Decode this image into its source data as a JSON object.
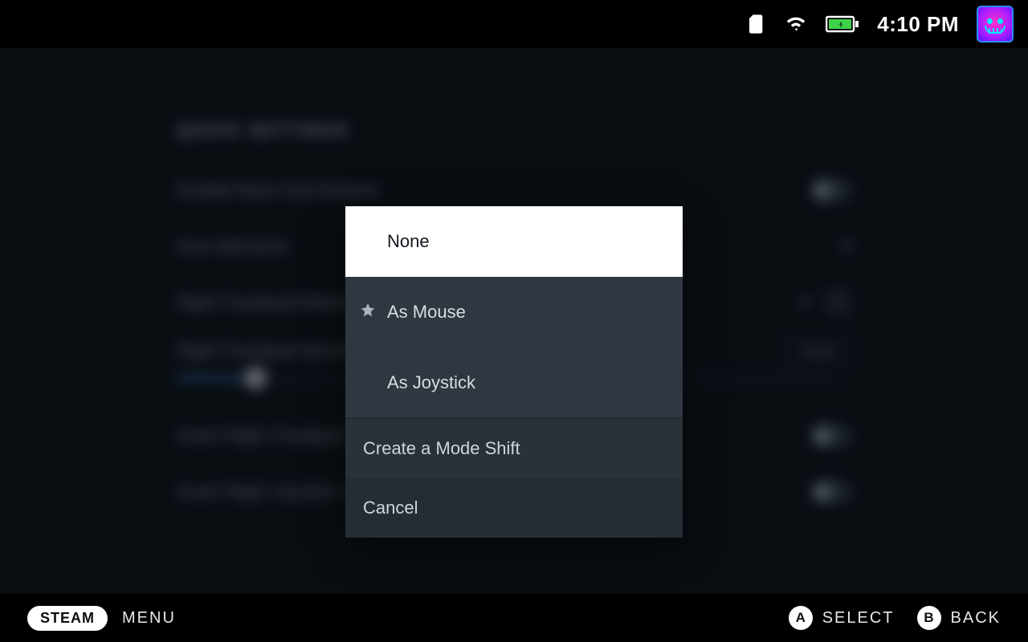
{
  "status": {
    "time": "4:10 PM"
  },
  "settings": {
    "section_title": "QUICK SETTINGS",
    "rows": {
      "r0": "Enable Back Grip Buttons",
      "r1": "Gyro Behavior",
      "r2": "Right Trackpad Behavior",
      "r3": "Right Trackpad Sensitivity",
      "invert_btn": "Invert",
      "r4": "Invert Right Trackpad Y-Axis",
      "r5": "Invert Right Joystick Y-Axis"
    }
  },
  "modal": {
    "options": {
      "o0": "None",
      "o1": "As Mouse",
      "o2": "As Joystick"
    },
    "create": "Create a Mode Shift",
    "cancel": "Cancel"
  },
  "footer": {
    "steam": "STEAM",
    "menu": "MENU",
    "a_key": "A",
    "a_label": "SELECT",
    "b_key": "B",
    "b_label": "BACK"
  }
}
